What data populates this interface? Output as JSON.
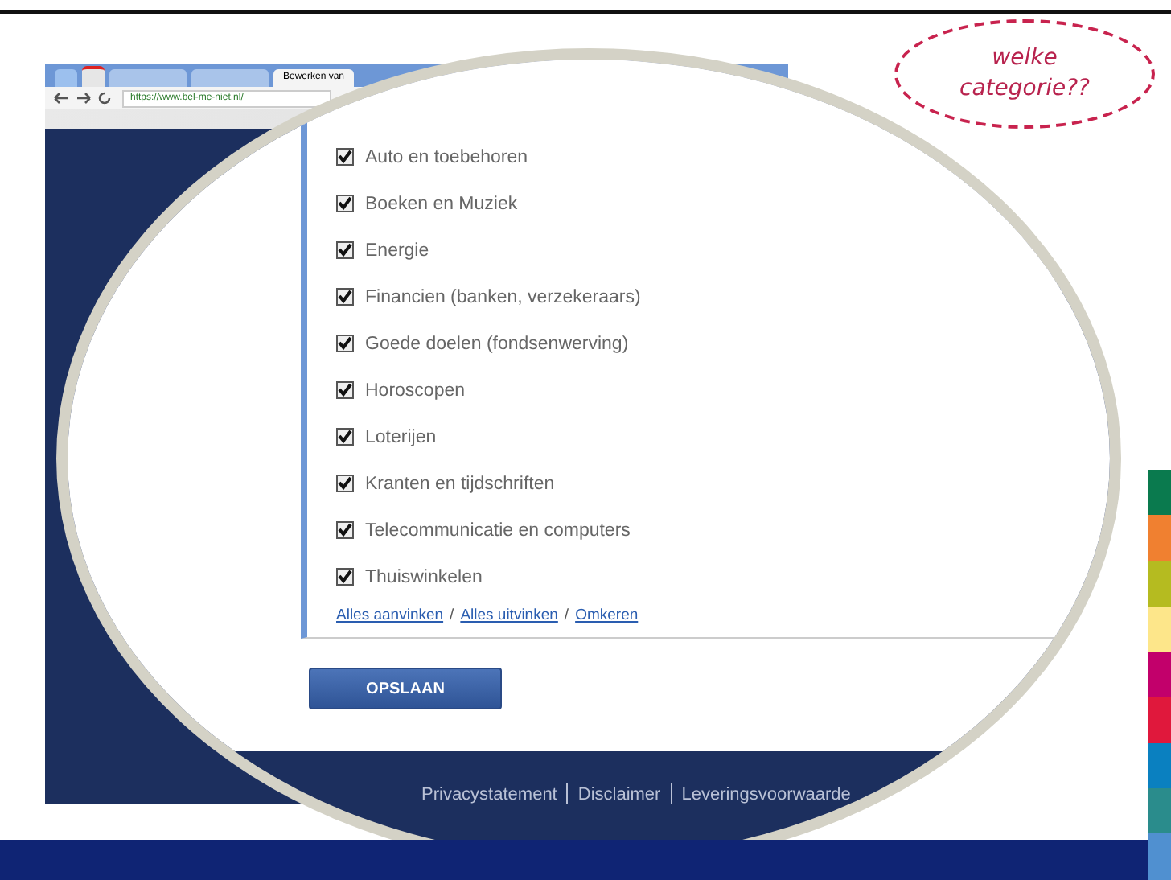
{
  "browser": {
    "url": "https://www.bel-me-niet.nl/",
    "tabs": [
      {
        "label": "Bewerken van",
        "selected": true
      }
    ]
  },
  "callout": {
    "lines": [
      "welke",
      "categorie??"
    ]
  },
  "categories": [
    {
      "label": "Auto en toebehoren",
      "checked": true
    },
    {
      "label": "Boeken en Muziek",
      "checked": true
    },
    {
      "label": "Energie",
      "checked": true
    },
    {
      "label": "Financien (banken, verzekeraars)",
      "checked": true
    },
    {
      "label": "Goede doelen (fondsenwerving)",
      "checked": true
    },
    {
      "label": "Horoscopen",
      "checked": true
    },
    {
      "label": "Loterijen",
      "checked": true
    },
    {
      "label": "Kranten en tijdschriften",
      "checked": true
    },
    {
      "label": "Telecommunicatie en computers",
      "checked": true
    },
    {
      "label": "Thuiswinkelen",
      "checked": true
    }
  ],
  "bulk_links": [
    "Alles aanvinken",
    "Alles uitvinken",
    "Omkeren"
  ],
  "bulk_link_separators": [
    "/",
    "/"
  ],
  "save_button": "OPSLAAN",
  "footer_links": [
    "Privacystatement",
    "Disclaimer",
    "Leveringsvoorwaarde"
  ],
  "color_strip": [
    {
      "color": "#0a7a4e"
    },
    {
      "color": "#f08030"
    },
    {
      "color": "#b5bb20"
    },
    {
      "color": "#fde68a"
    },
    {
      "color": "#c2006b"
    },
    {
      "color": "#e0183c"
    },
    {
      "color": "#0a80c0"
    },
    {
      "color": "#2a8c8c"
    },
    {
      "color": "#5090d0"
    }
  ]
}
